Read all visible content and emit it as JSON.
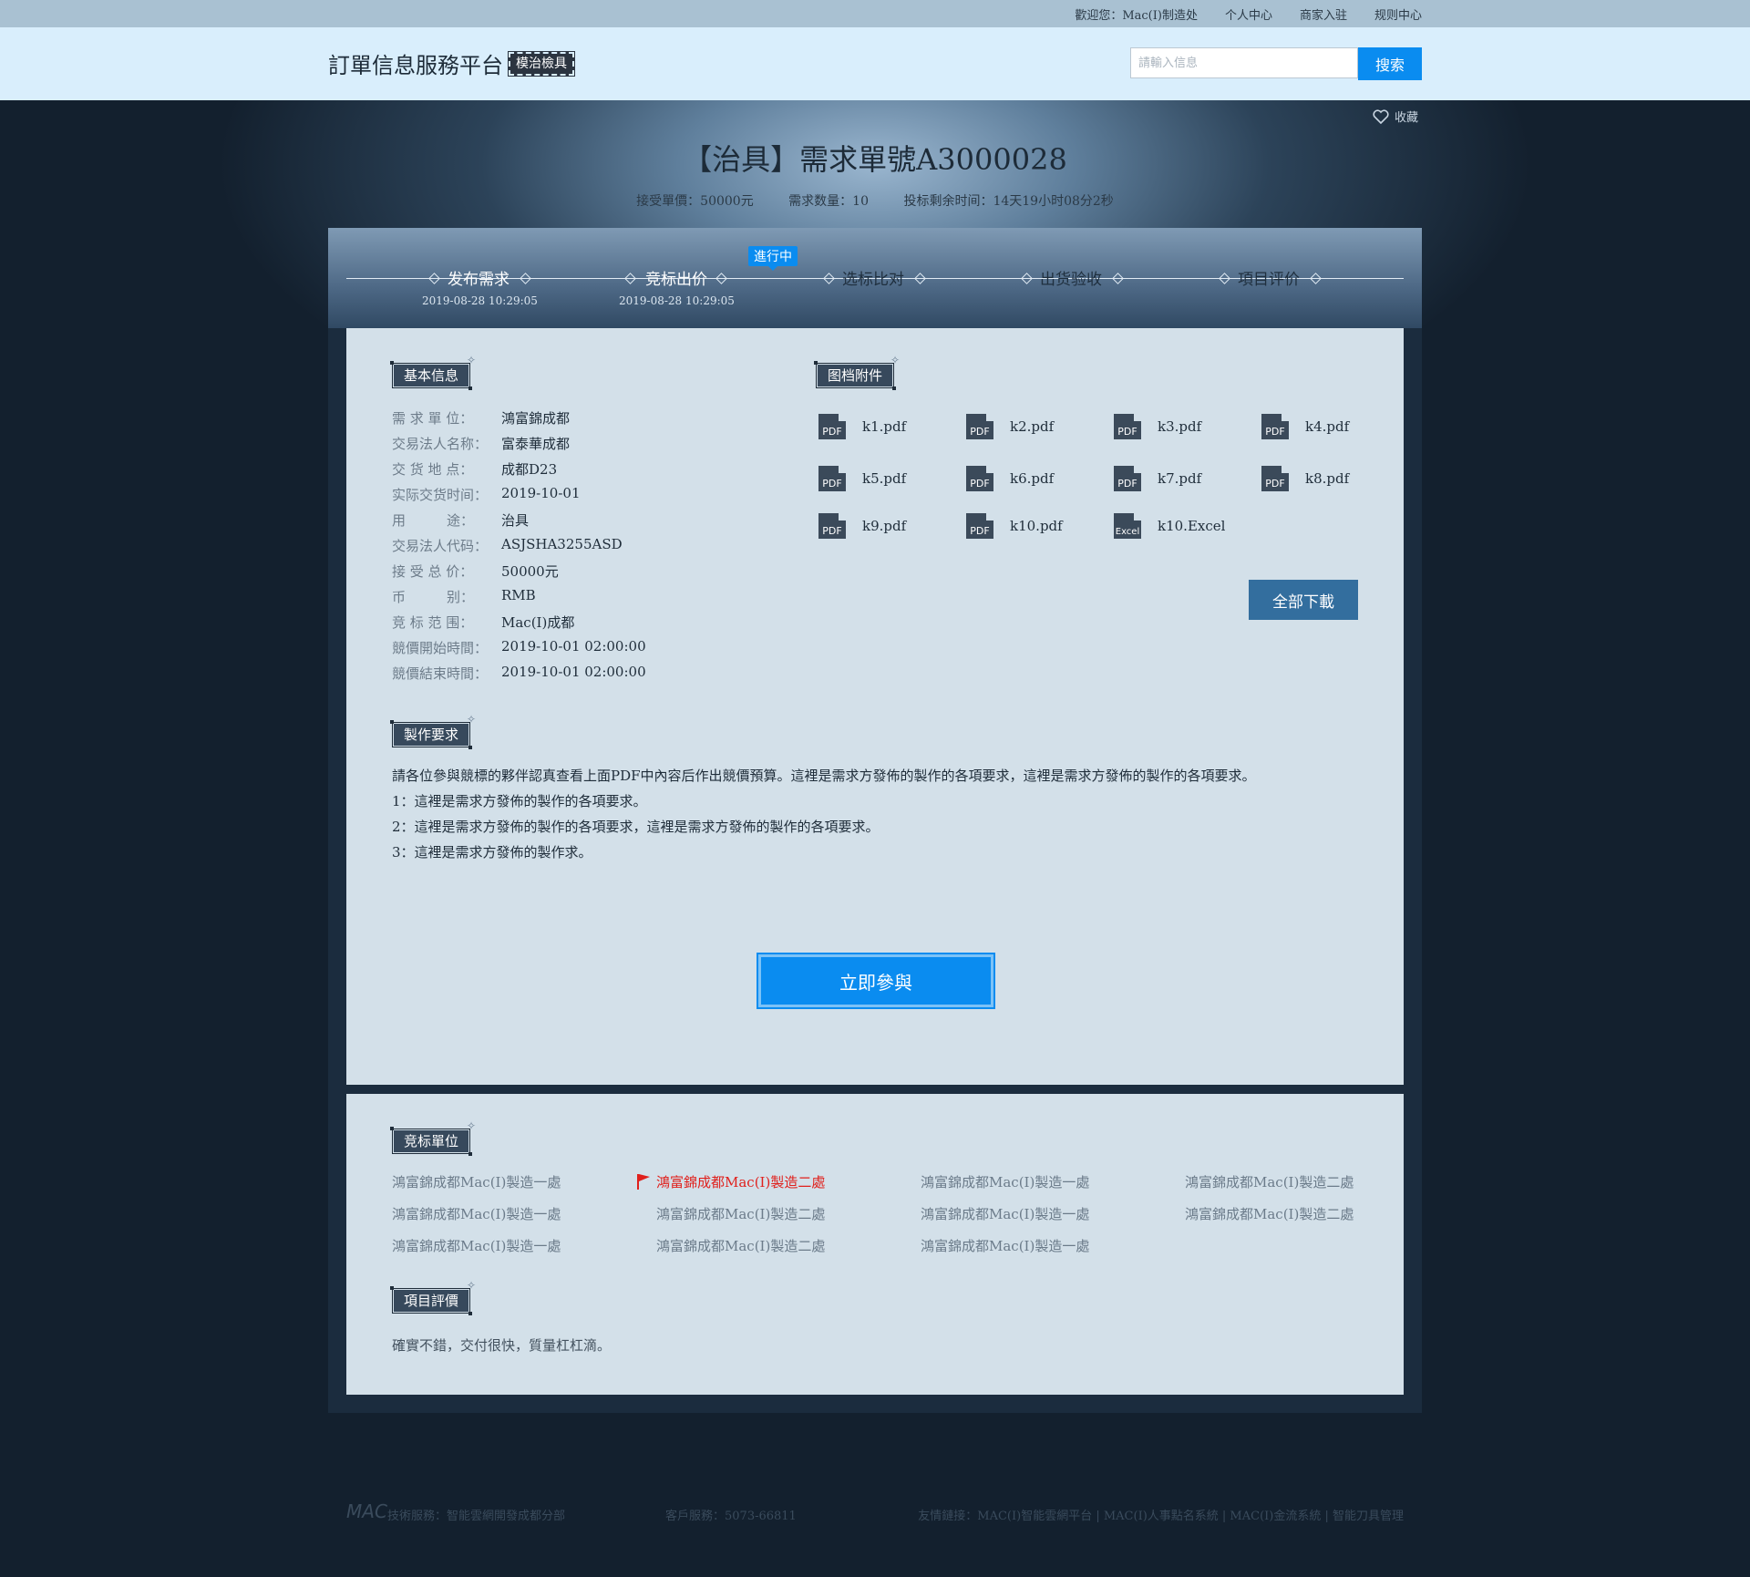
{
  "topbar": {
    "welcome": "歡迎您：Mac(I)制造处",
    "links": [
      "个人中心",
      "商家入驻",
      "规则中心"
    ]
  },
  "header": {
    "brand": "訂單信息服務平台",
    "badge": "模治檢具",
    "search_placeholder": "請輸入信息",
    "search_button": "搜索"
  },
  "favorite": "收藏",
  "title": "【治具】需求單號A3000028",
  "meta": {
    "price": "接受單價：50000元",
    "quantity": "需求数量：10",
    "remaining": "投标剩余时间：14天19小时08分2秒"
  },
  "steps": {
    "badge": "進行中",
    "items": [
      {
        "label": "发布需求",
        "date": "2019-08-28 10:29:05"
      },
      {
        "label": "竞标出价",
        "date": "2019-08-28 10:29:05"
      },
      {
        "label": "选标比对",
        "date": ""
      },
      {
        "label": "出货验收",
        "date": ""
      },
      {
        "label": "項目评价",
        "date": ""
      }
    ]
  },
  "basic": {
    "title": "基本信息",
    "rows": [
      {
        "label": "需 求 單 位：",
        "value": "鴻富錦成都"
      },
      {
        "label": "交易法人名称：",
        "value": "富泰華成都"
      },
      {
        "label": "交 货 地 点：",
        "value": "成都D23"
      },
      {
        "label": "实际交货时间：",
        "value": "2019-10-01"
      },
      {
        "label": "用　　　途：",
        "value": "治具"
      },
      {
        "label": "交易法人代码：",
        "value": "ASJSHA3255ASD"
      },
      {
        "label": "接 受 总 价：",
        "value": "50000元"
      },
      {
        "label": "币　　　别：",
        "value": "RMB"
      },
      {
        "label": "竞 标 范 围：",
        "value": "Mac(I)成都"
      },
      {
        "label": "競價開始時間：",
        "value": "2019-10-01 02:00:00"
      },
      {
        "label": "競價結束時間：",
        "value": "2019-10-01 02:00:00"
      }
    ]
  },
  "attachments": {
    "title": "图档附件",
    "files": [
      {
        "name": "k1.pdf",
        "type": "PDF"
      },
      {
        "name": "k2.pdf",
        "type": "PDF"
      },
      {
        "name": "k3.pdf",
        "type": "PDF"
      },
      {
        "name": "k4.pdf",
        "type": "PDF"
      },
      {
        "name": "k5.pdf",
        "type": "PDF"
      },
      {
        "name": "k6.pdf",
        "type": "PDF"
      },
      {
        "name": "k7.pdf",
        "type": "PDF"
      },
      {
        "name": "k8.pdf",
        "type": "PDF"
      },
      {
        "name": "k9.pdf",
        "type": "PDF"
      },
      {
        "name": "k10.pdf",
        "type": "PDF"
      },
      {
        "name": "k10.Excel",
        "type": "Excel"
      }
    ],
    "download_all": "全部下載"
  },
  "requirements": {
    "title": "製作要求",
    "lines": [
      "請各位參與競標的夥伴認真查看上面PDF中內容后作出競價預算。這裡是需求方發佈的製作的各項要求，這裡是需求方發佈的製作的各項要求。",
      "1：這裡是需求方發佈的製作的各項要求。",
      "2：這裡是需求方發佈的製作的各項要求，這裡是需求方發佈的製作的各項要求。",
      "3：這裡是需求方發佈的製作求。"
    ],
    "join_button": "立即參與"
  },
  "bidders": {
    "title": "竞标單位",
    "items": [
      {
        "name": "鴻富錦成都Mac(I)製造一處",
        "winner": false
      },
      {
        "name": "鴻富錦成都Mac(I)製造二處",
        "winner": true
      },
      {
        "name": "鴻富錦成都Mac(I)製造一處",
        "winner": false
      },
      {
        "name": "鴻富錦成都Mac(I)製造二處",
        "winner": false
      },
      {
        "name": "鴻富錦成都Mac(I)製造一處",
        "winner": false
      },
      {
        "name": "鴻富錦成都Mac(I)製造二處",
        "winner": false
      },
      {
        "name": "鴻富錦成都Mac(I)製造一處",
        "winner": false
      },
      {
        "name": "鴻富錦成都Mac(I)製造二處",
        "winner": false
      },
      {
        "name": "鴻富錦成都Mac(I)製造一處",
        "winner": false
      },
      {
        "name": "鴻富錦成都Mac(I)製造二處",
        "winner": false
      },
      {
        "name": "鴻富錦成都Mac(I)製造一處",
        "winner": false
      }
    ]
  },
  "evaluation": {
    "title": "項目評價",
    "text": "確實不錯，交付很快，質量杠杠滴。"
  },
  "footer": {
    "logo": "MAC",
    "tech": "技術服務：智能雲網開發成都分部",
    "service": "客戶服務：5073-66811",
    "links": "友情鏈接：MAC(I)智能雲網平台 | MAC(I)人事點名系統 | MAC(I)金流系統 | 智能刀具管理"
  },
  "colors": {
    "accent": "#0a8cf0",
    "winner": "#e0201c",
    "download": "#336e9e"
  }
}
